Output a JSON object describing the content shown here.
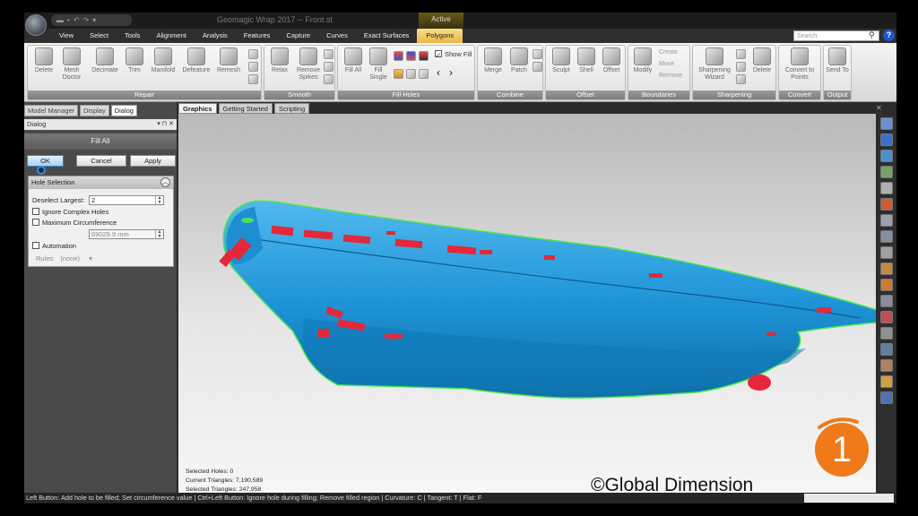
{
  "app": {
    "window_title": "Geomagic Wrap 2017 -- Front.st",
    "context_label": "Active"
  },
  "menu": {
    "tabs": [
      "View",
      "Select",
      "Tools",
      "Alignment",
      "Analysis",
      "Features",
      "Capture",
      "Curves",
      "Exact Surfaces",
      "Polygons"
    ],
    "active": "Polygons",
    "search_placeholder": "Search"
  },
  "ribbon": {
    "groups": {
      "repair": {
        "label": "Repair",
        "buttons": [
          "Delete",
          "Mesh Doctor",
          "Decimate",
          "Trim",
          "Manifold",
          "Defeature",
          "Remesh"
        ]
      },
      "smooth": {
        "label": "Smooth",
        "buttons": [
          "Relax",
          "Remove Spikes"
        ]
      },
      "fill_holes": {
        "label": "Fill Holes",
        "buttons": [
          "Fill All",
          "Fill Single"
        ],
        "show_fill": "Show Fill"
      },
      "combine": {
        "label": "Combine",
        "buttons": [
          "Merge",
          "Patch"
        ]
      },
      "offset": {
        "label": "Offset",
        "buttons": [
          "Sculpt",
          "Shell",
          "Offset"
        ]
      },
      "boundaries": {
        "label": "Boundaries",
        "buttons": [
          "Modify",
          "Create",
          "Move",
          "Remove"
        ]
      },
      "sharpening": {
        "label": "Sharpening",
        "buttons": [
          "Sharpening Wizard",
          "Delete"
        ]
      },
      "convert": {
        "label": "Convert",
        "buttons": [
          "Convert to Points"
        ]
      },
      "output": {
        "label": "Output",
        "buttons": [
          "Send To"
        ]
      }
    }
  },
  "left_panel": {
    "tabs": [
      "Model Manager",
      "Display",
      "Dialog"
    ],
    "active_tab": "Dialog",
    "dialog_header": "Dialog",
    "command_title": "Fill All",
    "buttons": {
      "ok": "OK",
      "cancel": "Cancel",
      "apply": "Apply"
    },
    "hole_selection": {
      "title": "Hole Selection",
      "deselect_largest_label": "Deselect Largest:",
      "deselect_largest_value": "2",
      "ignore_complex_holes": "Ignore Complex Holes",
      "maximum_circumference": "Maximum Circumference",
      "circumference_value": "69029.9 mm",
      "automation": "Automation",
      "rules_label": "Rules:",
      "rules_value": "(none)"
    }
  },
  "viewport": {
    "tabs": [
      "Graphics",
      "Getting Started",
      "Scripting"
    ],
    "active_tab": "Graphics",
    "stats": {
      "selected_holes": "Selected Holes: 0",
      "current_triangles": "Current Triangles: 7,190,589",
      "selected_triangles": "Selected Triangles: 247,958"
    },
    "watermark": "©Global Dimension",
    "badge_number": "1",
    "colors": {
      "mesh": "#2b9bd8",
      "holes": "#e8283a",
      "boundary": "#3fe04a",
      "badge": "#f07a1a"
    }
  },
  "statusbar": {
    "text": "Left Button: Add hole to be filled; Set circumference value | Ctrl+Left Button: Ignore hole during filling; Remove filled region | Curvature: C | Tangent: T | Flat: F"
  }
}
